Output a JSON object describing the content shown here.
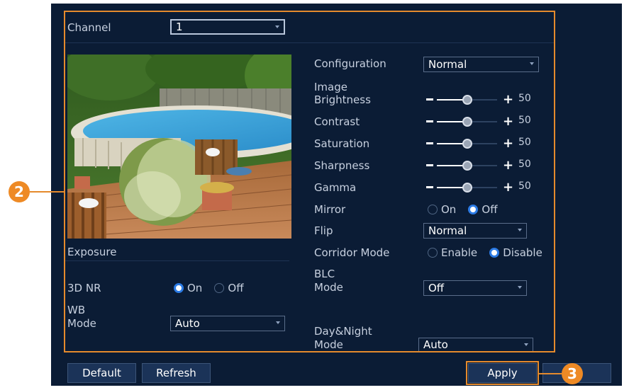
{
  "channel": {
    "label": "Channel",
    "value": "1"
  },
  "image_section_label": "Image",
  "settings": {
    "configuration": {
      "label": "Configuration",
      "value": "Normal"
    },
    "brightness": {
      "label": "Brightness",
      "value": 50,
      "value_text": "50"
    },
    "contrast": {
      "label": "Contrast",
      "value": 50,
      "value_text": "50"
    },
    "saturation": {
      "label": "Saturation",
      "value": 50,
      "value_text": "50"
    },
    "sharpness": {
      "label": "Sharpness",
      "value": 50,
      "value_text": "50"
    },
    "gamma": {
      "label": "Gamma",
      "value": 50,
      "value_text": "50"
    },
    "mirror": {
      "label": "Mirror",
      "options": [
        "On",
        "Off"
      ],
      "selected": "Off"
    },
    "flip": {
      "label": "Flip",
      "value": "Normal"
    },
    "corridor_mode": {
      "label": "Corridor Mode",
      "options": [
        "Enable",
        "Disable"
      ],
      "selected": "Disable"
    },
    "blc_mode": {
      "label_line1": "BLC",
      "label_line2": "Mode",
      "value": "Off"
    },
    "day_night_mode": {
      "label_line1": "Day&Night",
      "label_line2": "Mode",
      "value": "Auto"
    }
  },
  "left": {
    "exposure_label": "Exposure",
    "nr3d": {
      "label": "3D NR",
      "options": [
        "On",
        "Off"
      ],
      "selected": "On"
    },
    "wb_mode": {
      "label_line1": "WB",
      "label_line2": "Mode",
      "value": "Auto"
    }
  },
  "slider_symbols": {
    "minus": "−",
    "plus": "+"
  },
  "buttons": {
    "default": "Default",
    "refresh": "Refresh",
    "apply": "Apply"
  },
  "callouts": {
    "settings_region": "2",
    "apply_step": "3"
  },
  "colors": {
    "accent": "#e58a2c",
    "panel": "#0b1c35",
    "radio_selected": "#2c7be5"
  }
}
